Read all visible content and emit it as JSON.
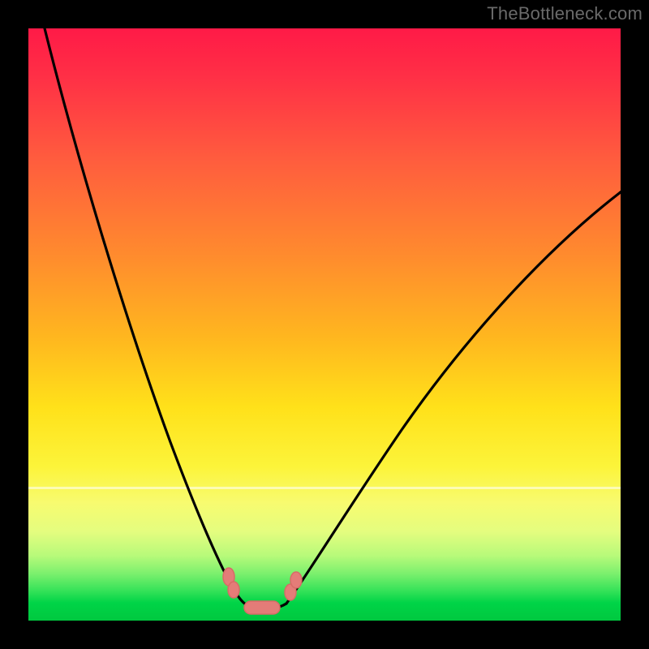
{
  "watermark": "TheBottleneck.com",
  "colors": {
    "curve_stroke": "#000000",
    "marker_fill": "#e47c78",
    "marker_stroke": "#d86b67",
    "background_frame": "#000000"
  },
  "chart_data": {
    "type": "line",
    "title": "",
    "xlabel": "",
    "ylabel": "",
    "xlim": [
      0,
      100
    ],
    "ylim": [
      0,
      100
    ],
    "grid": false,
    "legend": false,
    "note": "Bottleneck-style V-curve. No tick labels rendered. Values estimated from pixel positions normalized to 0–100. Curve minimum ≈ x 36–41, y ≈ 3.",
    "x": [
      3,
      6,
      10,
      14,
      18,
      22,
      26,
      30,
      34,
      36,
      38,
      40,
      42,
      46,
      50,
      55,
      60,
      66,
      72,
      80,
      88,
      96,
      100
    ],
    "y": [
      97,
      90,
      80,
      70,
      60,
      50,
      41,
      31,
      18,
      8,
      4,
      4,
      7,
      15,
      24,
      33,
      41,
      49,
      56,
      64,
      71,
      77,
      80
    ],
    "markers": {
      "y": 7,
      "x_range": [
        33.5,
        43.0
      ],
      "description": "small pink dot cluster along bottom of the V / flat minimum segment"
    }
  }
}
